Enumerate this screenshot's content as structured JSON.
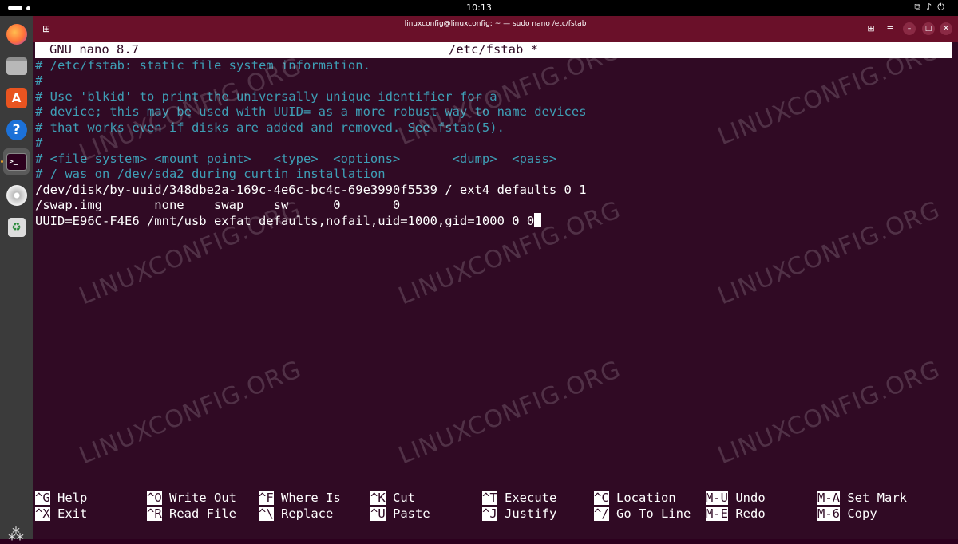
{
  "topbar": {
    "clock": "10:13"
  },
  "window": {
    "title": "linuxconfig@linuxconfig: ~ — sudo nano /etc/fstab"
  },
  "nano": {
    "version": "GNU nano 8.7",
    "filename": "/etc/fstab *"
  },
  "file_lines": [
    {
      "type": "comment",
      "text": "# /etc/fstab: static file system information."
    },
    {
      "type": "comment",
      "text": "#"
    },
    {
      "type": "comment",
      "text": "# Use 'blkid' to print the universally unique identifier for a"
    },
    {
      "type": "comment",
      "text": "# device; this may be used with UUID= as a more robust way to name devices"
    },
    {
      "type": "comment",
      "text": "# that works even if disks are added and removed. See fstab(5)."
    },
    {
      "type": "comment",
      "text": "#"
    },
    {
      "type": "comment",
      "text": "# <file system> <mount point>   <type>  <options>       <dump>  <pass>"
    },
    {
      "type": "comment",
      "text": "# / was on /dev/sda2 during curtin installation"
    },
    {
      "type": "normal",
      "text": "/dev/disk/by-uuid/348dbe2a-169c-4e6c-bc4c-69e3990f5539 / ext4 defaults 0 1"
    },
    {
      "type": "normal",
      "text": "/swap.img       none    swap    sw      0       0"
    },
    {
      "type": "normal",
      "text": "UUID=E96C-F4E6 /mnt/usb exfat defaults,nofail,uid=1000,gid=1000 0 0"
    }
  ],
  "shortcuts": [
    {
      "key": "^G",
      "label": "Help"
    },
    {
      "key": "^X",
      "label": "Exit"
    },
    {
      "key": "^O",
      "label": "Write Out"
    },
    {
      "key": "^R",
      "label": "Read File"
    },
    {
      "key": "^F",
      "label": "Where Is"
    },
    {
      "key": "^\\",
      "label": "Replace"
    },
    {
      "key": "^K",
      "label": "Cut"
    },
    {
      "key": "^U",
      "label": "Paste"
    },
    {
      "key": "^T",
      "label": "Execute"
    },
    {
      "key": "^J",
      "label": "Justify"
    },
    {
      "key": "^C",
      "label": "Location"
    },
    {
      "key": "^/",
      "label": "Go To Line"
    },
    {
      "key": "M-U",
      "label": "Undo"
    },
    {
      "key": "M-E",
      "label": "Redo"
    },
    {
      "key": "M-A",
      "label": "Set Mark"
    },
    {
      "key": "M-6",
      "label": "Copy"
    }
  ],
  "dock": [
    "firefox-icon",
    "files-icon",
    "app-center-icon",
    "help-icon",
    "terminal-icon",
    "disc-icon",
    "trash-icon",
    "show-apps-icon"
  ],
  "watermark": "LINUXCONFIG.ORG",
  "colors": {
    "titlebar": "#6a1029",
    "terminal_bg": "#300a24",
    "comment": "#3e9fb6"
  }
}
